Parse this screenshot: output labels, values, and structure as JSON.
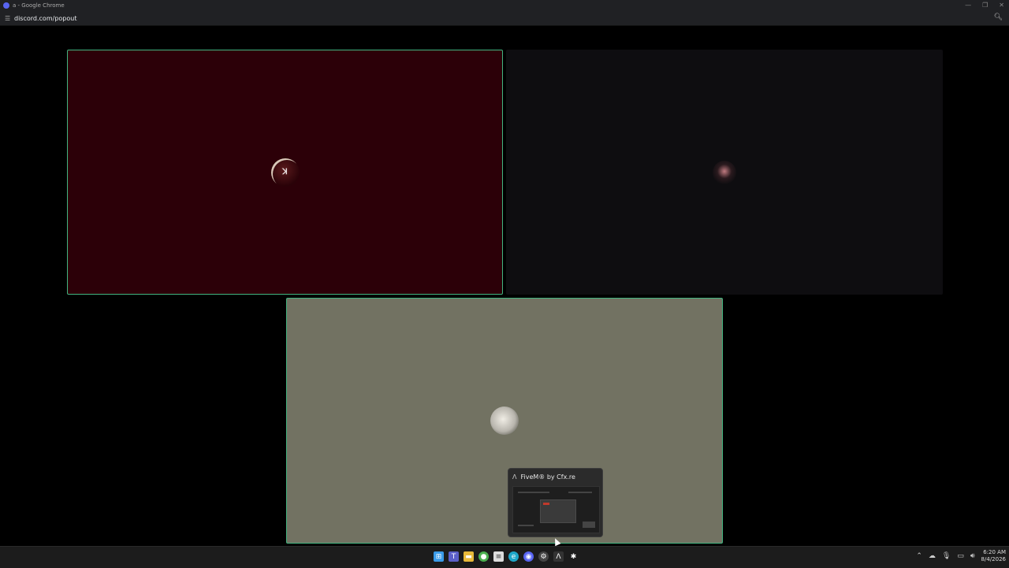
{
  "window": {
    "title": "a - Google Chrome",
    "url": "discord.com/popout"
  },
  "tiles": [
    {
      "name": "participant-1",
      "bg": "#2c0008",
      "avatar_text": "ꓘ"
    },
    {
      "name": "participant-2",
      "bg": "#0e0d10",
      "avatar_text": ""
    },
    {
      "name": "participant-3",
      "bg": "#727262",
      "avatar_text": ""
    }
  ],
  "colors": {
    "speaking_border": "#43b581",
    "taskbar_bg": "#1c1c1c"
  },
  "taskbar_preview": {
    "title": "FiveM® by Cfx.re"
  },
  "taskbar": {
    "icons": [
      "windows-start",
      "teams",
      "file-explorer",
      "chrome",
      "notepad",
      "edge",
      "discord",
      "steam",
      "fivem",
      "settings"
    ]
  },
  "clock": {
    "time": "6:20 AM",
    "date": "8/4/2026"
  }
}
